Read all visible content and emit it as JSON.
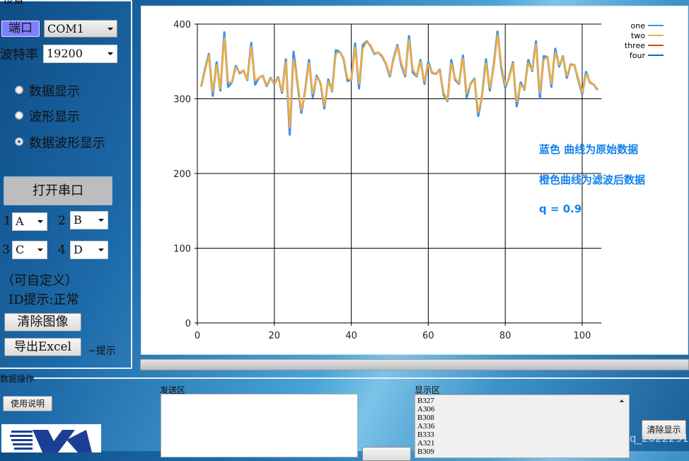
{
  "settings": {
    "group_title": "设置",
    "port_label": "端口",
    "port_value": "COM1",
    "baud_label": "波特率",
    "baud_value": "19200",
    "display_modes": [
      {
        "label": "数据显示",
        "selected": false
      },
      {
        "label": "波形显示",
        "selected": false
      },
      {
        "label": "数据波形显示",
        "selected": true
      }
    ],
    "open_port_button": "打开串口",
    "channels": [
      {
        "num": "1",
        "value": "A"
      },
      {
        "num": "2",
        "value": "B"
      },
      {
        "num": "3",
        "value": "C"
      },
      {
        "num": "4",
        "value": "D"
      }
    ],
    "custom_hint": "（可自定义）",
    "id_status": "ID提示:正常",
    "clear_image_button": "清除图像",
    "export_excel_button": "导出Excel",
    "hint_label": "~提示"
  },
  "chart": {
    "notes": [
      "蓝色 曲线为原始数据",
      "橙色曲线为滤波后数据",
      "q = 0.9"
    ]
  },
  "chart_data": {
    "type": "line",
    "xlim": [
      0,
      105
    ],
    "ylim": [
      0,
      400
    ],
    "xticks": [
      0,
      20,
      40,
      60,
      80,
      100
    ],
    "yticks": [
      0,
      100,
      200,
      300,
      400
    ],
    "grid": true,
    "legend": "top-right",
    "x_start": 1,
    "series": [
      {
        "name": "one",
        "color": "#3a8ff0",
        "values": [
          316,
          340,
          360,
          304,
          349,
          311,
          389,
          316,
          322,
          344,
          334,
          338,
          325,
          375,
          319,
          328,
          331,
          317,
          328,
          320,
          329,
          308,
          353,
          252,
          363,
          322,
          281,
          310,
          352,
          302,
          331,
          321,
          287,
          326,
          310,
          365,
          363,
          354,
          324,
          325,
          374,
          314,
          372,
          377,
          371,
          360,
          362,
          357,
          347,
          330,
          354,
          372,
          345,
          330,
          384,
          335,
          330,
          352,
          320,
          349,
          335,
          333,
          339,
          305,
          297,
          352,
          325,
          320,
          358,
          302,
          320,
          327,
          277,
          305,
          353,
          311,
          344,
          390,
          341,
          315,
          328,
          349,
          290,
          322,
          312,
          352,
          337,
          377,
          301,
          357,
          356,
          316,
          367,
          343,
          357,
          328,
          346,
          345,
          325,
          306,
          336,
          322,
          319,
          312
        ]
      },
      {
        "name": "two",
        "color": "#f5ad3c",
        "values": [
          316,
          338,
          358,
          309,
          345,
          314,
          382,
          323,
          322,
          342,
          335,
          338,
          326,
          370,
          324,
          328,
          331,
          318,
          327,
          321,
          328,
          310,
          349,
          262,
          353,
          325,
          285,
          308,
          348,
          307,
          329,
          322,
          291,
          323,
          311,
          360,
          363,
          355,
          327,
          325,
          369,
          320,
          367,
          376,
          372,
          361,
          362,
          358,
          348,
          332,
          352,
          370,
          348,
          332,
          379,
          339,
          331,
          350,
          323,
          346,
          336,
          333,
          338,
          308,
          298,
          347,
          327,
          321,
          354,
          307,
          319,
          326,
          282,
          303,
          348,
          315,
          341,
          385,
          345,
          318,
          327,
          347,
          296,
          319,
          313,
          348,
          338,
          373,
          308,
          352,
          356,
          320,
          362,
          345,
          356,
          331,
          345,
          345,
          327,
          308,
          333,
          323,
          319,
          313
        ]
      },
      {
        "name": "three",
        "color": "#d9421b",
        "values": []
      },
      {
        "name": "four",
        "color": "#1b6a9e",
        "values": []
      }
    ]
  },
  "data_ops": {
    "group_title": "数据操作",
    "help_button": "使用说明",
    "send_label": "发送区",
    "send_value": "",
    "display_label": "显示区",
    "display_lines": [
      "B327",
      "A306",
      "B308",
      "A336",
      "B333",
      "A321",
      "B309"
    ],
    "clear_display_button": "清除显示"
  },
  "watermark": "https://blog.csdn.net/qq_20222919"
}
